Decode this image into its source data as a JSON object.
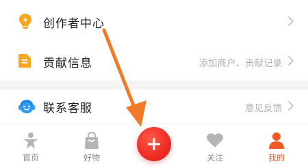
{
  "menu": {
    "items": [
      {
        "label": "创作者中心",
        "icon": "lightbulb-icon",
        "hint": ""
      },
      {
        "label": "贡献信息",
        "icon": "document-icon",
        "hint": "添加商户、贡献记录"
      },
      {
        "label": "联系客服",
        "icon": "headset-icon",
        "hint": "意见反馈"
      }
    ]
  },
  "tabbar": {
    "tabs": [
      {
        "label": "首页",
        "icon": "home-icon",
        "active": false
      },
      {
        "label": "好物",
        "icon": "shopping-bag-icon",
        "active": false
      },
      {
        "label": "",
        "icon": "plus-icon",
        "active": false
      },
      {
        "label": "关注",
        "icon": "heart-icon",
        "active": false
      },
      {
        "label": "我的",
        "icon": "profile-icon",
        "active": true
      }
    ]
  },
  "colors": {
    "accent": "#f05a22",
    "icon_orange": "#f5a623",
    "fab_red": "#ee2a24",
    "service_blue": "#2e9bf0",
    "annotation_arrow": "#f07a2a"
  },
  "annotation": {
    "icon": "pointer-arrow-icon"
  }
}
